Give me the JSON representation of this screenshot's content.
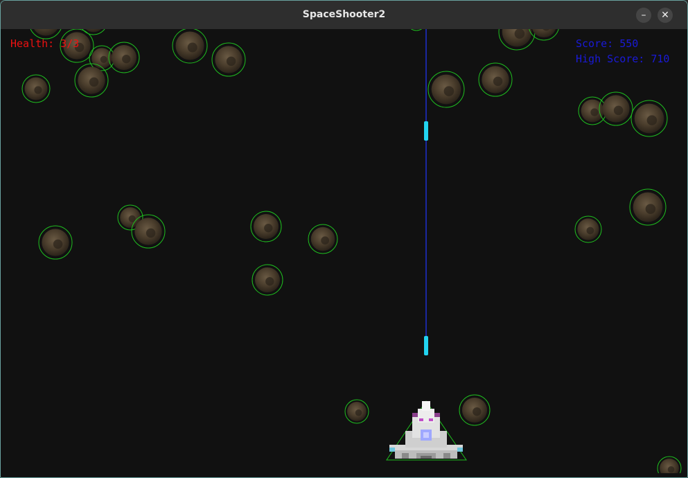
{
  "window": {
    "title": "SpaceShooter2",
    "minimize_label": "–",
    "close_label": "✕",
    "minimize_icon": "minimize-icon",
    "close_icon": "close-icon"
  },
  "hud": {
    "health": "Health: 3/3",
    "score": "Score: 550",
    "high_score": "High Score: 710"
  },
  "colors": {
    "background": "#111111",
    "health_text": "#ee1111",
    "score_text": "#1a1ad8",
    "hitbox": "#1fbf1f",
    "laser_track": "#1f2fd0",
    "laser_bolt": "#22d3f0"
  },
  "sprites": {
    "asteroid": "asteroid-sprite",
    "player_ship": "player-spaceship-sprite",
    "bullet": "laser-bolt-sprite"
  },
  "counts": {
    "asteroids_visible": 31,
    "bullets_visible": 2
  }
}
